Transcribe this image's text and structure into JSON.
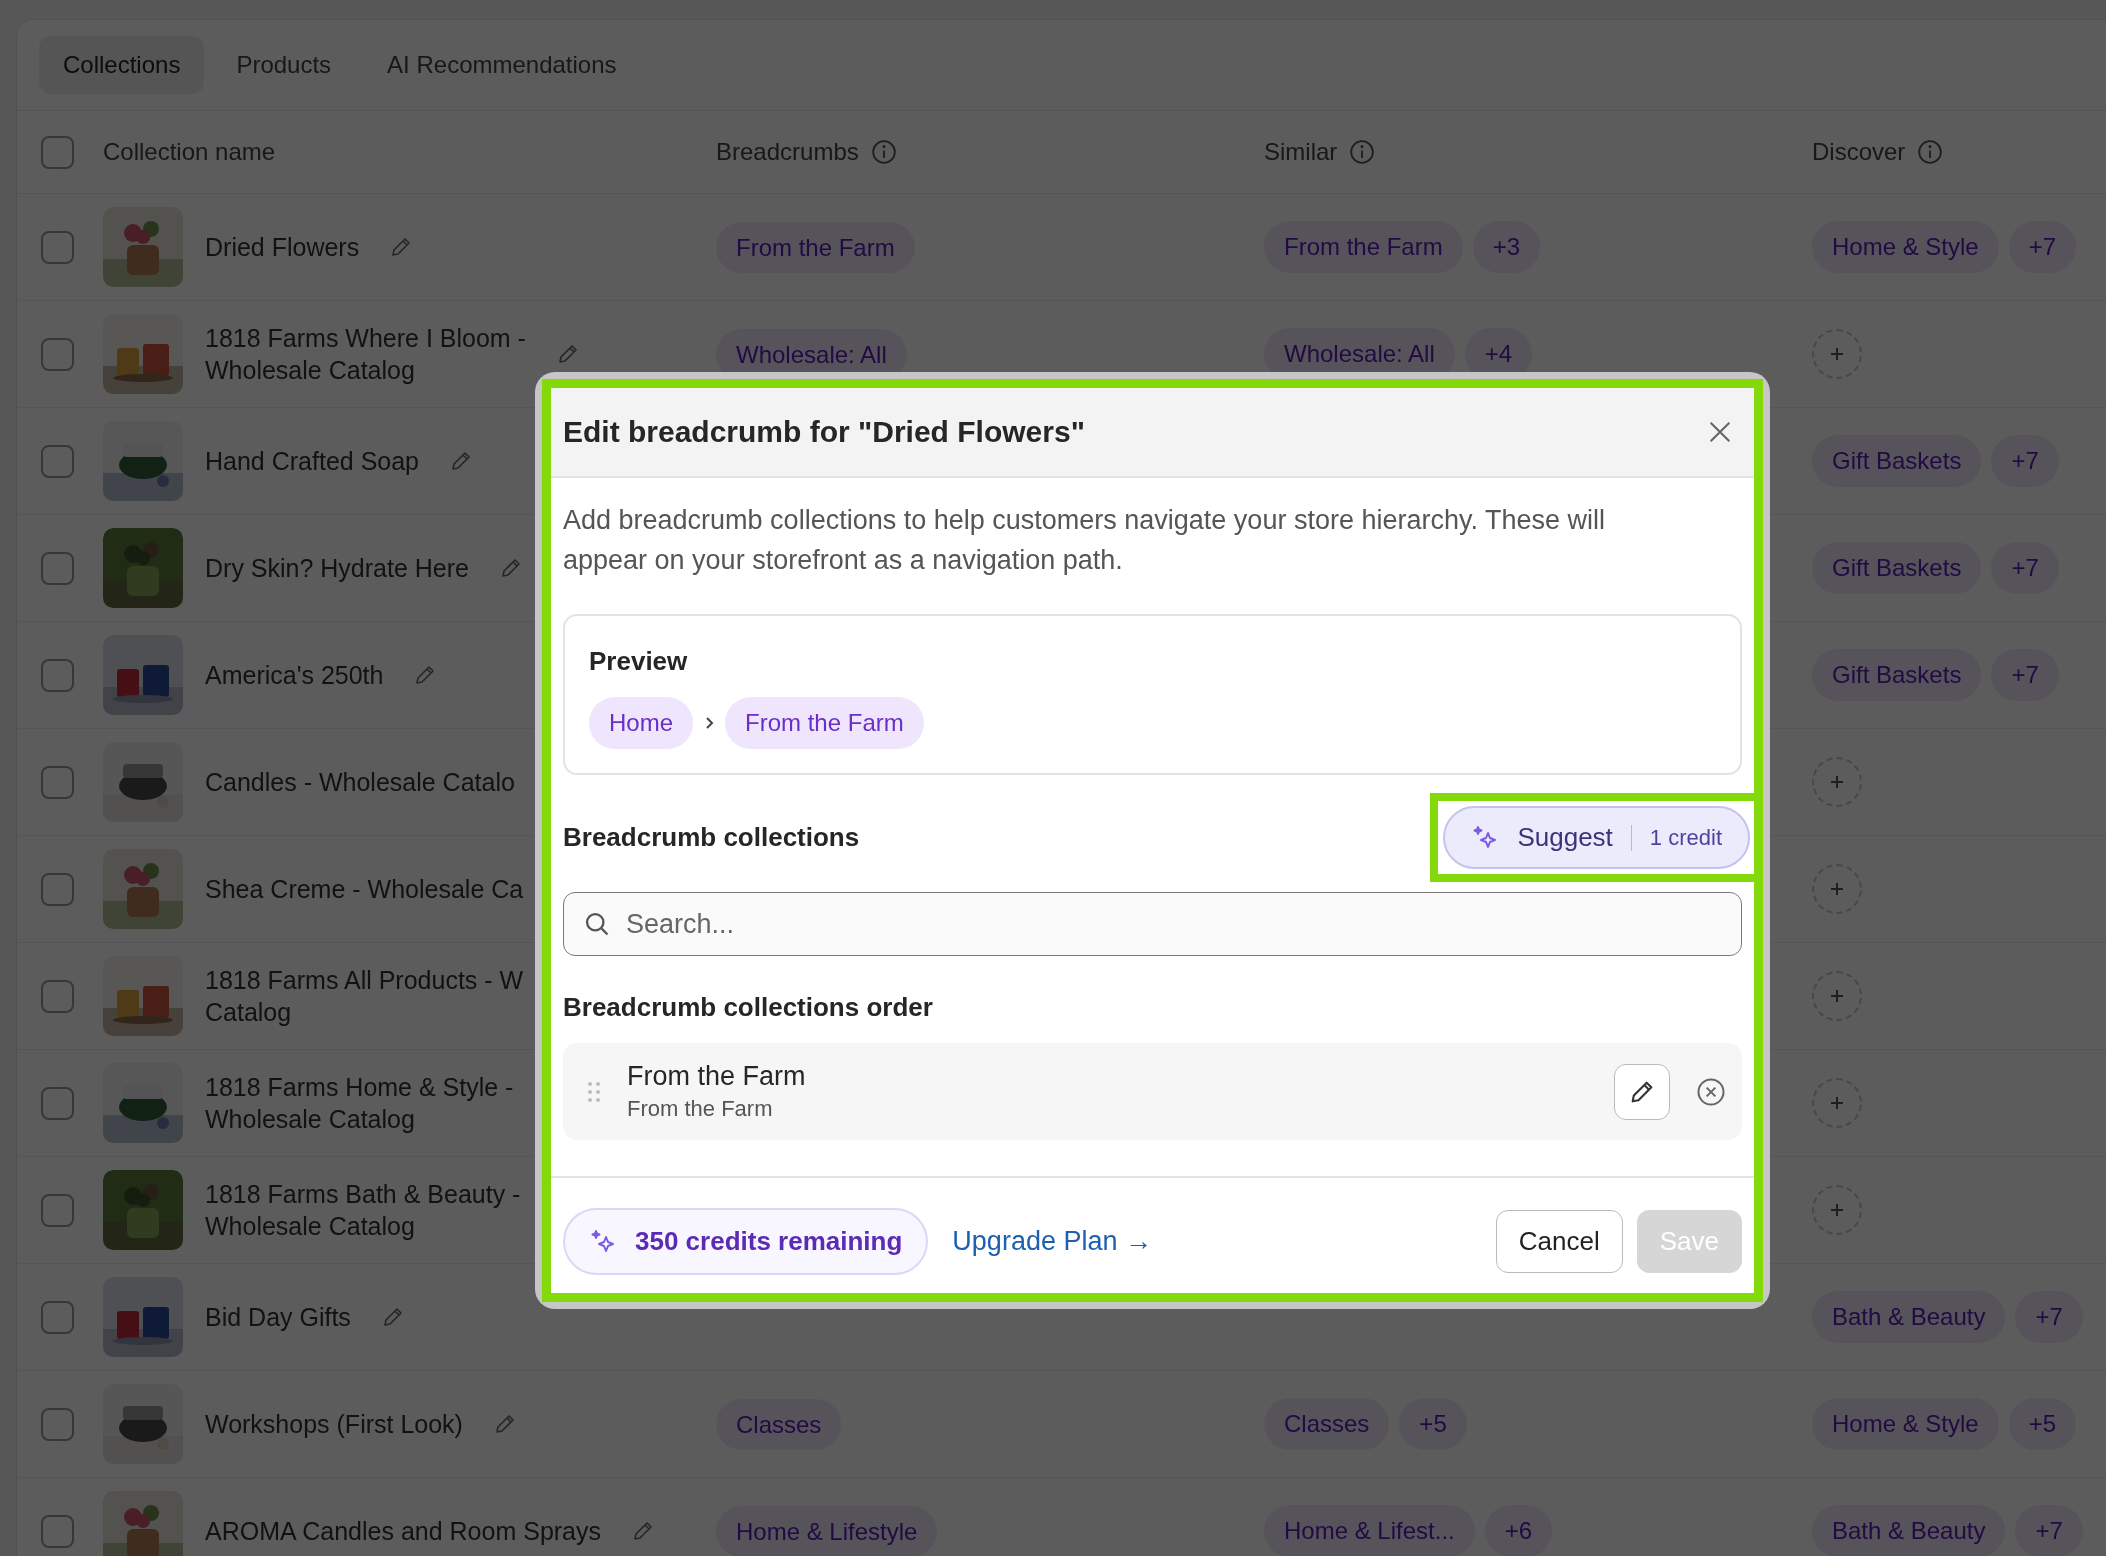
{
  "tabs": [
    {
      "label": "Collections",
      "selected": true
    },
    {
      "label": "Products",
      "selected": false
    },
    {
      "label": "AI Recommendations",
      "selected": false
    }
  ],
  "table": {
    "select_all": {
      "checked": false
    },
    "columns": [
      {
        "label": "Collection name",
        "info": false
      },
      {
        "label": "Breadcrumbs",
        "info": true
      },
      {
        "label": "Similar",
        "info": true
      },
      {
        "label": "Discover",
        "info": true
      }
    ],
    "rows": [
      {
        "checked": false,
        "name": "Dried Flowers",
        "edit_icon": true,
        "breadcrumb": "From the Farm",
        "similar": {
          "label": "From the Farm",
          "more": "+3"
        },
        "discover": {
          "kind": "tags",
          "label": "Home & Style",
          "more": "+7"
        }
      },
      {
        "checked": false,
        "name": "1818 Farms Where I Bloom -\nWholesale Catalog",
        "edit_icon": true,
        "breadcrumb": "Wholesale: All",
        "similar": {
          "label": "Wholesale: All",
          "more": "+4"
        },
        "discover": {
          "kind": "add"
        }
      },
      {
        "checked": false,
        "name": "Hand Crafted Soap",
        "edit_icon": true,
        "discover": {
          "kind": "tags",
          "label": "Gift Baskets",
          "more": "+7"
        }
      },
      {
        "checked": false,
        "name": "Dry Skin? Hydrate Here",
        "edit_icon": true,
        "discover": {
          "kind": "tags",
          "label": "Gift Baskets",
          "more": "+7"
        }
      },
      {
        "checked": false,
        "name": "America's 250th",
        "edit_icon": true,
        "discover": {
          "kind": "tags",
          "label": "Gift Baskets",
          "more": "+7"
        }
      },
      {
        "checked": false,
        "name": "Candles - Wholesale Catalo",
        "edit_icon": false,
        "discover": {
          "kind": "add"
        }
      },
      {
        "checked": false,
        "name": "Shea Creme - Wholesale Ca",
        "edit_icon": false,
        "discover": {
          "kind": "add"
        }
      },
      {
        "checked": false,
        "name": "1818 Farms All Products - W\nCatalog",
        "edit_icon": false,
        "discover": {
          "kind": "add"
        }
      },
      {
        "checked": false,
        "name": "1818 Farms Home & Style -\nWholesale Catalog",
        "edit_icon": false,
        "discover": {
          "kind": "add"
        }
      },
      {
        "checked": false,
        "name": "1818 Farms Bath & Beauty -\nWholesale Catalog",
        "edit_icon": false,
        "discover": {
          "kind": "add"
        }
      },
      {
        "checked": false,
        "name": "Bid Day Gifts",
        "edit_icon": true,
        "discover": {
          "kind": "tags",
          "label": "Bath & Beauty",
          "more": "+7"
        }
      },
      {
        "checked": false,
        "name": "Workshops (First Look)",
        "edit_icon": true,
        "breadcrumb": "Classes",
        "similar": {
          "label": "Classes",
          "more": "+5"
        },
        "discover": {
          "kind": "tags",
          "label": "Home & Style",
          "more": "+5"
        }
      },
      {
        "checked": false,
        "name": "AROMA Candles and Room Sprays",
        "edit_icon": true,
        "breadcrumb": "Home & Lifestyle",
        "similar": {
          "label": "Home & Lifest...",
          "more": "+6"
        },
        "discover": {
          "kind": "tags",
          "label": "Bath & Beauty",
          "more": "+7"
        }
      }
    ]
  },
  "dialog": {
    "title": "Edit breadcrumb for \"Dried Flowers\"",
    "description": "Add breadcrumb collections to help customers navigate your store hierarchy. These will appear on your storefront as a navigation path.",
    "preview": {
      "heading": "Preview",
      "path": [
        "Home",
        "From the Farm"
      ]
    },
    "collections": {
      "heading": "Breadcrumb collections",
      "suggest": {
        "label": "Suggest",
        "cost": "1 credit"
      },
      "search": {
        "placeholder": "Search..."
      }
    },
    "order": {
      "heading": "Breadcrumb collections order",
      "items": [
        {
          "title": "From the Farm",
          "subtitle": "From the Farm"
        }
      ]
    },
    "footer": {
      "credits": "**350** credits remaining",
      "upgrade_link": "Upgrade Plan →",
      "cancel": "Cancel",
      "save": {
        "label": "Save",
        "disabled": true
      }
    }
  }
}
